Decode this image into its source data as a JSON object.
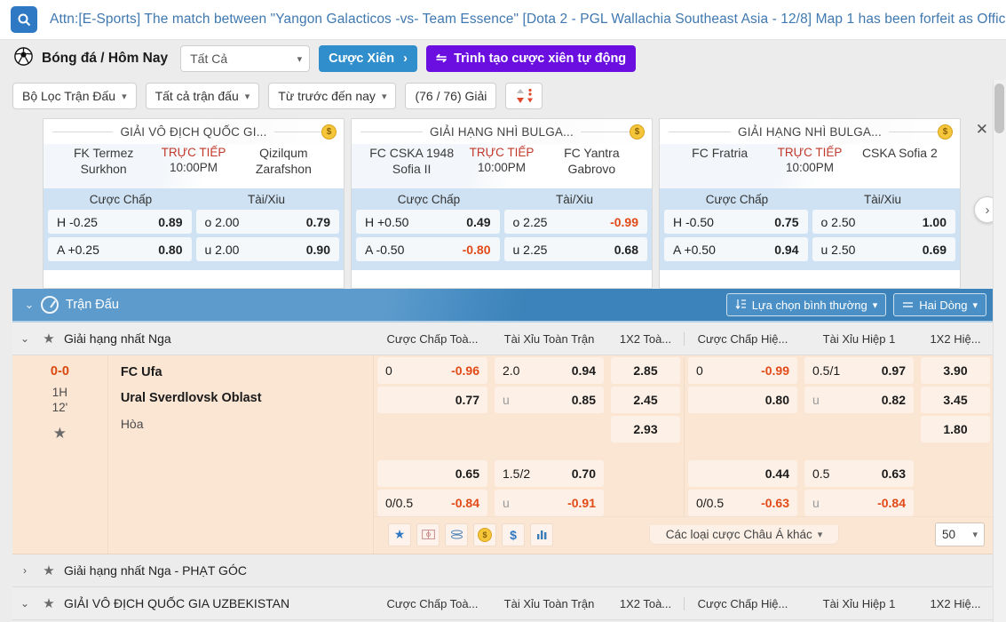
{
  "announcement": {
    "icon": "search-icon",
    "text": "Attn:[E-Sports] The match between \"Yangon Galacticos -vs- Team Essence\" [Dota 2 - PGL Wallachia Southeast Asia - 12/8] Map 1 has been forfeit as Offici"
  },
  "toolbar": {
    "sport_icon": "soccer-ball-icon",
    "breadcrumb": "Bóng đá / Hôm Nay",
    "all_select": "Tất Cả",
    "parlay_button": "Cược Xiên",
    "parlay_arrow": "›",
    "auto_parlay_button": "Trình tạo cược xiên tự động",
    "filters": [
      {
        "label": "Bộ Lọc Trận Đấu",
        "caret": "⌄"
      },
      {
        "label": "Tất cả trận đấu",
        "caret": "⌄"
      },
      {
        "label": "Từ trước đến nay",
        "caret": "⌄"
      }
    ],
    "count_label": "(76 / 76) Giải",
    "sort_icon": "sort-arrows-icon"
  },
  "carousel": {
    "close_icon": "close-icon",
    "next_icon": "chevron-right-icon",
    "odds_headers": {
      "handicap": "Cược Chấp",
      "ou": "Tài/Xiu"
    },
    "cards": [
      {
        "title": "GIẢI VÔ ĐỊCH QUỐC GI...",
        "coin": "$",
        "home": "FK Termez Surkhon",
        "away": "Qizilqum Zarafshon",
        "live_label": "TRỰC TIẾP",
        "time": "10:00PM",
        "rows": [
          {
            "h_line": "H -0.25",
            "h_odd": "0.89",
            "h_neg": false,
            "ou_line": "o 2.00",
            "ou_odd": "0.79",
            "ou_neg": false
          },
          {
            "h_line": "A +0.25",
            "h_odd": "0.80",
            "h_neg": false,
            "ou_line": "u 2.00",
            "ou_odd": "0.90",
            "ou_neg": false
          }
        ]
      },
      {
        "title": "GIẢI HẠNG NHÌ BULGA...",
        "coin": "$",
        "home": "FC CSKA 1948 Sofia II",
        "away": "FC Yantra Gabrovo",
        "live_label": "TRỰC TIẾP",
        "time": "10:00PM",
        "rows": [
          {
            "h_line": "H +0.50",
            "h_odd": "0.49",
            "h_neg": false,
            "ou_line": "o 2.25",
            "ou_odd": "-0.99",
            "ou_neg": true
          },
          {
            "h_line": "A -0.50",
            "h_odd": "-0.80",
            "h_neg": true,
            "ou_line": "u 2.25",
            "ou_odd": "0.68",
            "ou_neg": false
          }
        ]
      },
      {
        "title": "GIẢI HẠNG NHÌ BULGA...",
        "coin": "$",
        "home": "FC Fratria",
        "away": "CSKA Sofia 2",
        "live_label": "TRỰC TIẾP",
        "time": "10:00PM",
        "rows": [
          {
            "h_line": "H -0.50",
            "h_odd": "0.75",
            "h_neg": false,
            "ou_line": "o 2.50",
            "ou_odd": "1.00",
            "ou_neg": false
          },
          {
            "h_line": "A +0.50",
            "h_odd": "0.94",
            "h_neg": false,
            "ou_line": "u 2.50",
            "ou_odd": "0.69",
            "ou_neg": false
          }
        ]
      }
    ]
  },
  "match_bar": {
    "caret": "⌄",
    "clock_icon": "clock-icon",
    "title": "Trận Đấu",
    "normal_select": "Lựa chọn bình thường",
    "normal_select_icon": "sort-list-icon",
    "two_rows": "Hai Dòng",
    "two_rows_icon": "rows-icon",
    "caret_small": "⌄"
  },
  "columns": [
    "Cược Chấp Toà...",
    "Tài Xỉu Toàn Trận",
    "1X2 Toà...",
    "Cược Chấp Hiệ...",
    "Tài Xỉu Hiệp 1",
    "1X2 Hiệ..."
  ],
  "league_row": {
    "caret": "⌄",
    "star_icon": "star-icon",
    "name": "Giải hạng nhất Nga"
  },
  "match": {
    "score": "0-0",
    "period": "1H",
    "minute": "12'",
    "star_icon": "star-icon",
    "home": "FC Ufa",
    "away": "Ural Sverdlovsk Oblast",
    "draw": "Hòa",
    "full_time": {
      "handicap": [
        {
          "line": "0",
          "odd": "-0.96",
          "neg": true
        },
        {
          "line": "",
          "odd": "0.77",
          "neg": false
        }
      ],
      "ou": [
        {
          "line": "2.0",
          "odd": "0.94",
          "neg": false,
          "dim": false
        },
        {
          "line": "u",
          "odd": "0.85",
          "neg": false,
          "dim": true
        }
      ],
      "x12": [
        {
          "odd": "2.85"
        },
        {
          "odd": "2.45"
        },
        {
          "odd": "2.93"
        }
      ],
      "handicap2": [
        {
          "line": "",
          "odd": "0.65",
          "neg": false
        },
        {
          "line": "0/0.5",
          "odd": "-0.84",
          "neg": true
        }
      ],
      "ou2": [
        {
          "line": "1.5/2",
          "odd": "0.70",
          "neg": false,
          "dim": false
        },
        {
          "line": "u",
          "odd": "-0.91",
          "neg": true,
          "dim": true
        }
      ]
    },
    "first_half": {
      "handicap": [
        {
          "line": "0",
          "odd": "-0.99",
          "neg": true
        },
        {
          "line": "",
          "odd": "0.80",
          "neg": false
        }
      ],
      "ou": [
        {
          "line": "0.5/1",
          "odd": "0.97",
          "neg": false,
          "dim": false
        },
        {
          "line": "u",
          "odd": "0.82",
          "neg": false,
          "dim": true
        }
      ],
      "x12": [
        {
          "odd": "3.90"
        },
        {
          "odd": "3.45"
        },
        {
          "odd": "1.80"
        }
      ],
      "handicap2": [
        {
          "line": "",
          "odd": "0.44",
          "neg": false
        },
        {
          "line": "0/0.5",
          "odd": "-0.63",
          "neg": true
        }
      ],
      "ou2": [
        {
          "line": "0.5",
          "odd": "0.63",
          "neg": false,
          "dim": false
        },
        {
          "line": "u",
          "odd": "-0.84",
          "neg": true,
          "dim": true
        }
      ]
    },
    "footer_icons": [
      "star-icon",
      "pitch-icon",
      "stack-icon",
      "coin-icon",
      "dollar-icon",
      "stats-icon"
    ],
    "other_bets": "Các loại cược Châu Á khác",
    "other_bets_caret": "⌄",
    "count_value": "50",
    "count_caret": "⌄"
  },
  "bottom_rows": [
    {
      "caret": "›",
      "star_icon": "star-icon",
      "name": "Giải hạng nhất Nga - PHẠT GÓC",
      "show_columns": false
    },
    {
      "caret": "⌄",
      "star_icon": "star-icon",
      "name": "GIẢI VÔ ĐỊCH QUỐC GIA UZBEKISTAN",
      "show_columns": true
    }
  ],
  "colors": {
    "accent_blue": "#2f8ecb",
    "purple": "#6a0fe0",
    "live_red": "#c0392b",
    "neg_orange": "#e24a18",
    "match_bg": "#fbe6d4"
  }
}
